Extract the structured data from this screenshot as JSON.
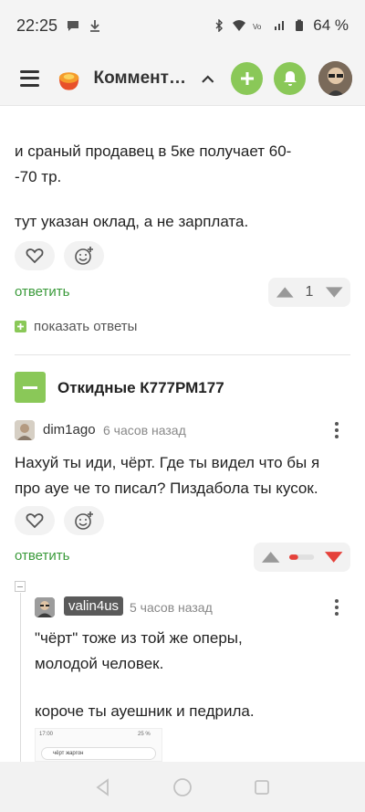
{
  "status_bar": {
    "time": "22:25",
    "battery": "64 %"
  },
  "header": {
    "title": "Комментарии",
    "accent_color": "#8ac858"
  },
  "comments": [
    {
      "partial_text_line1": "и сраный продавец в 5ке получает 60-",
      "partial_text_line2": "-70 тр.",
      "partial_text_line3": "тут указан оклад, а не зарплата.",
      "reply_label": "ответить",
      "rating": "1",
      "show_replies_label": "показать ответы"
    },
    {
      "post_title": "Откидные К777РМ177",
      "author": "dim1ago",
      "time": "6 часов назад",
      "text_line1": "Нахуй ты иди, чёрт. Где ты видел что бы я",
      "text_line2": "про ауе че то писал? Пиздабола ты кусок.",
      "reply_label": "ответить"
    },
    {
      "author": "valin4us",
      "time": "5 часов назад",
      "text_line1": "\"чёрт\" тоже из той же оперы,",
      "text_line2": "молодой человек.",
      "text_line3": "короче ты ауешник и педрила.",
      "screenshot": {
        "status": "17:00",
        "battery": "25 %",
        "search_text": "чёрт жаргон"
      }
    }
  ]
}
